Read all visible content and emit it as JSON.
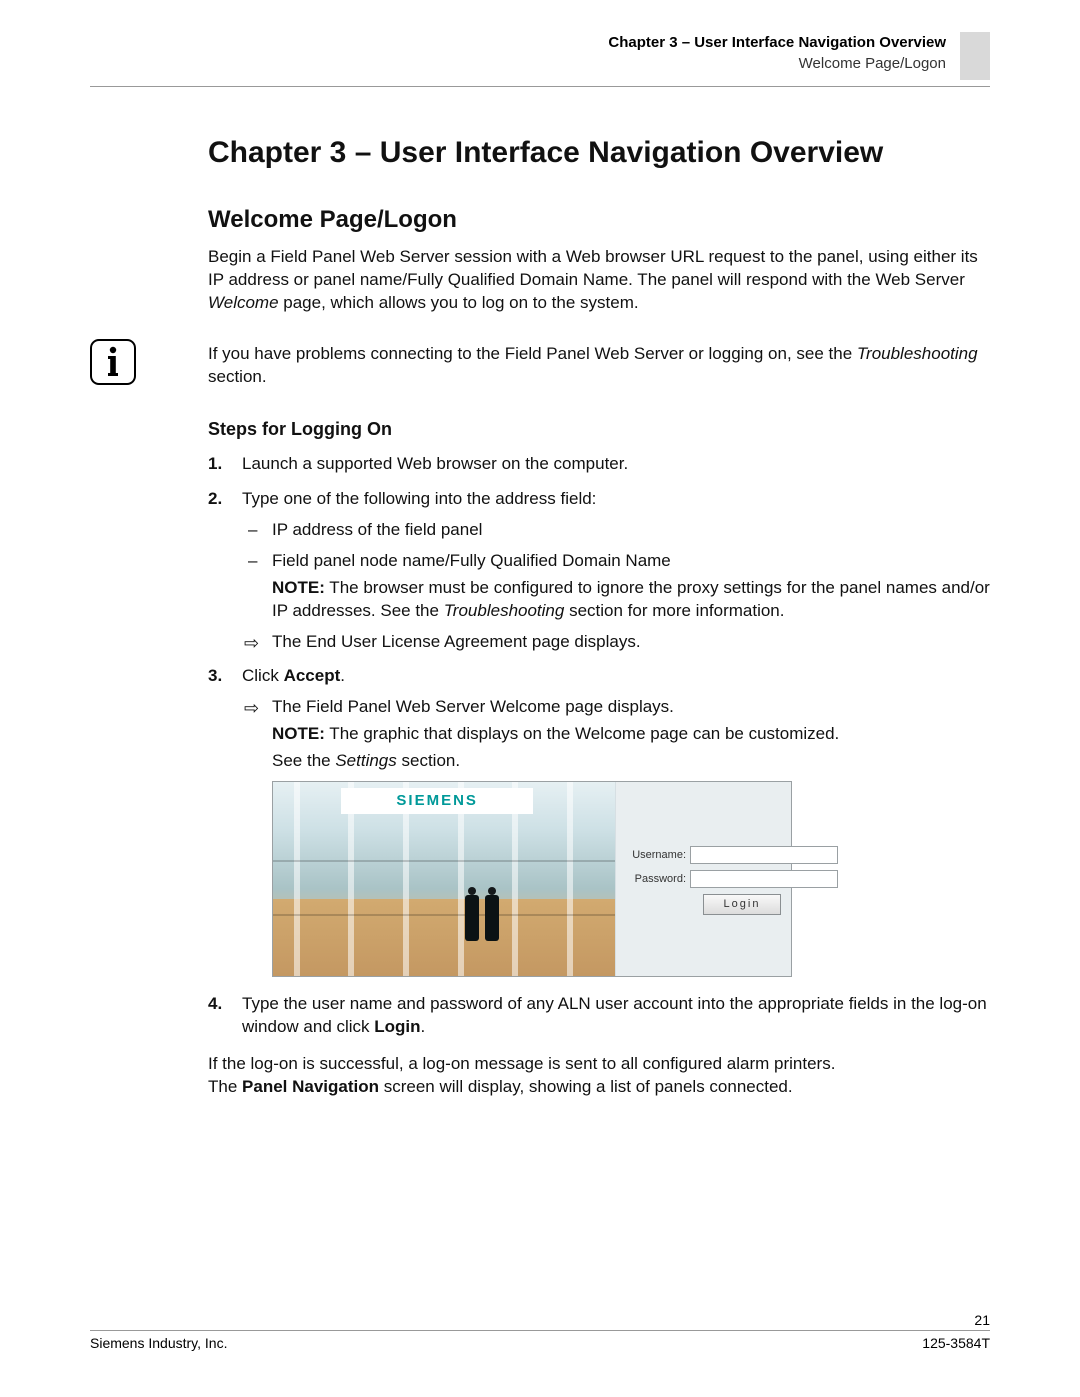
{
  "header": {
    "chapter_ref": "Chapter 3 – User Interface Navigation Overview",
    "section_ref": "Welcome Page/Logon"
  },
  "title": "Chapter 3 – User Interface Navigation Overview",
  "section": "Welcome Page/Logon",
  "intro_pre": "Begin a Field Panel Web Server session with a Web browser URL request to the panel, using either its IP address or panel name/Fully Qualified Domain Name. The panel will respond with the Web Server ",
  "intro_em": "Welcome",
  "intro_post": " page, which allows you to log on to the system.",
  "note_pre": "If you have problems connecting to the Field Panel Web Server or logging on, see the ",
  "note_em": "Troubleshooting",
  "note_post": " section.",
  "steps_heading": "Steps for Logging On",
  "step1": "Launch a supported Web browser on the computer.",
  "step2": "Type one of the following into the address field:",
  "step2a": "IP address of the field panel",
  "step2b": "Field panel node name/Fully Qualified Domain Name",
  "step2b_note_pre": "NOTE:",
  "step2b_note_body_pre": " The browser must be configured to ignore the proxy settings for the panel names and/or IP addresses. See the ",
  "step2b_note_em": "Troubleshooting",
  "step2b_note_body_post": " section for more information.",
  "step2_result": "The End User License Agreement page displays.",
  "step3_pre": "Click ",
  "step3_bold": "Accept",
  "step3_post": ".",
  "step3_result": "The Field Panel Web Server Welcome page displays.",
  "step3_note_pre": "NOTE:",
  "step3_note_body": " The graphic that displays on the Welcome page can be customized.",
  "step3_see_pre": "See the ",
  "step3_see_em": "Settings",
  "step3_see_post": " section.",
  "screenshot": {
    "logo": "SIEMENS",
    "username_label": "Username:",
    "password_label": "Password:",
    "login_button": "Login"
  },
  "step4_pre": "Type the user name and password of any ALN user account into the appropriate fields in the log-on window and click ",
  "step4_bold": "Login",
  "step4_post": ".",
  "after1": "If the log-on is successful, a log-on message is sent to all configured alarm printers.",
  "after2_pre": "The ",
  "after2_bold": "Panel Navigation",
  "after2_post": " screen will display, showing a list of panels connected.",
  "footer": {
    "page_number": "21",
    "company": "Siemens Industry, Inc.",
    "doc_id": "125-3584T"
  }
}
